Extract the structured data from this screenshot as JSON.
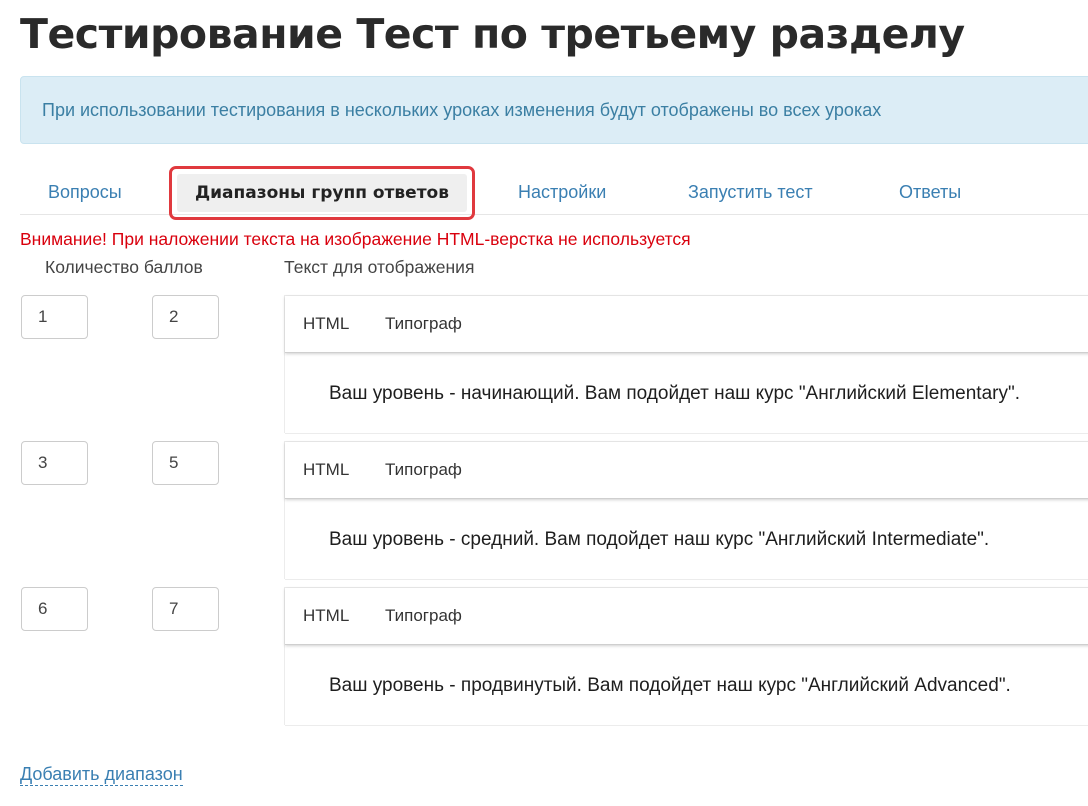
{
  "page": {
    "title": "Тестирование Тест по третьему разделу"
  },
  "info_alert": {
    "text": "При использовании тестирования в нескольких уроках изменения будут отображены во всех уроках"
  },
  "tabs": [
    {
      "label": "Вопросы",
      "active": false
    },
    {
      "label": "Диапазоны групп ответов",
      "active": true
    },
    {
      "label": "Настройки",
      "active": false
    },
    {
      "label": "Запустить тест",
      "active": false
    },
    {
      "label": "Ответы",
      "active": false
    }
  ],
  "warning": {
    "text": "Внимание! При наложении текста на изображение HTML-верстка не используется"
  },
  "columns": {
    "score_label": "Количество баллов",
    "text_label": "Текст для отображения"
  },
  "editor_toolbar": {
    "html_label": "HTML",
    "typograph_label": "Типограф"
  },
  "ranges": [
    {
      "from": "1",
      "to": "2",
      "text": "Ваш уровень - начинающий. Вам подойдет наш курс \"Английский Elementary\"."
    },
    {
      "from": "3",
      "to": "5",
      "text": "Ваш уровень - средний. Вам подойдет наш курс \"Английский Intermediate\"."
    },
    {
      "from": "6",
      "to": "7",
      "text": "Ваш уровень - продвинутый. Вам подойдет наш курс \"Английский Advanced\"."
    }
  ],
  "add_range": {
    "label": "Добавить диапазон"
  },
  "colors": {
    "link": "#3a7fb2",
    "warning": "#d9000d",
    "alert_bg": "#dcedf6",
    "alert_text": "#3b7fa3",
    "highlight_border": "#e0393e"
  }
}
